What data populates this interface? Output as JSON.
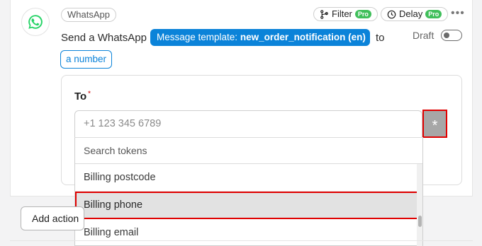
{
  "step": {
    "app_label": "WhatsApp",
    "filter_label": "Filter",
    "delay_label": "Delay",
    "pro_badge": "Pro",
    "sentence_prefix": "Send a WhatsApp",
    "template_prefix": "Message template:",
    "template_name": "new_order_notification (en)",
    "sentence_to": "to",
    "recipient_pill": "a number",
    "status_label": "Draft",
    "status_enabled": false
  },
  "form": {
    "to_label": "To",
    "required_mark": "*",
    "to_placeholder": "+1 123 345 6789",
    "token_button": "*"
  },
  "dropdown": {
    "search_placeholder": "Search tokens",
    "options": [
      "Billing postcode",
      "Billing phone",
      "Billing email"
    ],
    "selected_option": "Billing phone"
  },
  "footer": {
    "add_action_label": "Add action"
  },
  "colors": {
    "accent": "#0b83d9",
    "pro_badge": "#3fbf5a",
    "highlight_outline": "#e00000",
    "whatsapp_green": "#25d366"
  },
  "icons": {
    "app": "whatsapp-icon",
    "filter": "filter-branch-icon",
    "delay": "clock-icon",
    "more": "more-dots-icon"
  }
}
